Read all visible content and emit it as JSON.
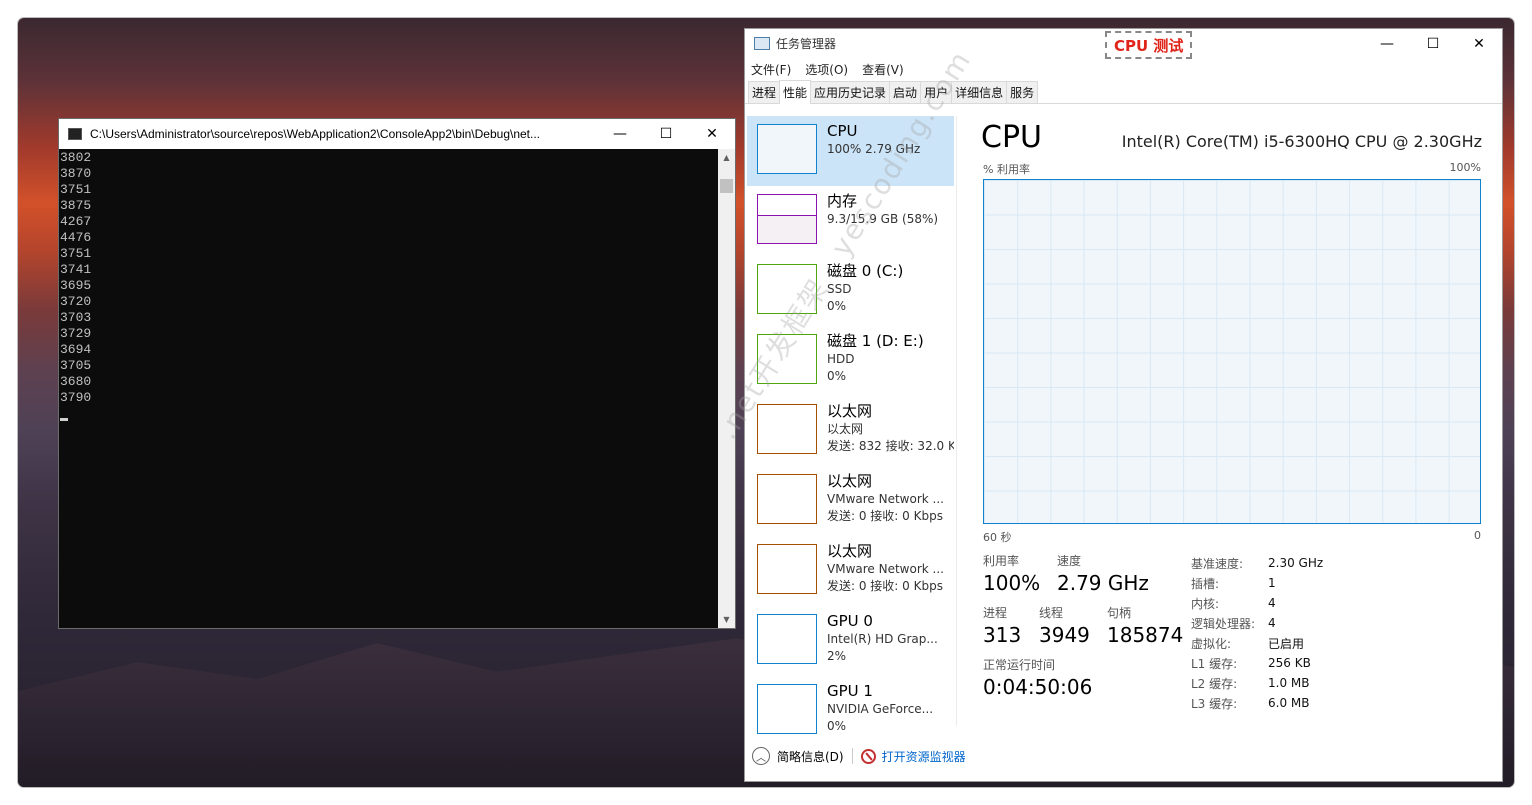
{
  "console": {
    "title": "C:\\Users\\Administrator\\source\\repos\\WebApplication2\\ConsoleApp2\\bin\\Debug\\net...",
    "minimize": "—",
    "maximize": "☐",
    "close": "✕",
    "lines": [
      "3802",
      "3870",
      "3751",
      "3875",
      "4267",
      "4476",
      "3751",
      "3741",
      "3695",
      "3720",
      "3703",
      "3729",
      "3694",
      "3705",
      "3680",
      "3790"
    ]
  },
  "annotation": {
    "label": "CPU 测试"
  },
  "taskmgr": {
    "title": "任务管理器",
    "minimize": "—",
    "maximize": "☐",
    "close": "✕",
    "menu": [
      "文件(F)",
      "选项(O)",
      "查看(V)"
    ],
    "tabs": [
      "进程",
      "性能",
      "应用历史记录",
      "启动",
      "用户",
      "详细信息",
      "服务"
    ],
    "active_tab": "性能",
    "items": [
      {
        "name": "CPU",
        "sub1": "100%  2.79 GHz",
        "sub2": "",
        "color": "#1183cc"
      },
      {
        "name": "内存",
        "sub1": "9.3/15.9 GB (58%)",
        "sub2": "",
        "color": "#8b12ae"
      },
      {
        "name": "磁盘 0 (C:)",
        "sub1": "SSD",
        "sub2": "0%",
        "color": "#4da60c"
      },
      {
        "name": "磁盘 1 (D: E:)",
        "sub1": "HDD",
        "sub2": "0%",
        "color": "#4da60c"
      },
      {
        "name": "以太网",
        "sub1": "以太网",
        "sub2": "发送: 832  接收: 32.0 K",
        "color": "#a74f01"
      },
      {
        "name": "以太网",
        "sub1": "VMware Network ...",
        "sub2": "发送: 0  接收: 0 Kbps",
        "color": "#a74f01"
      },
      {
        "name": "以太网",
        "sub1": "VMware Network ...",
        "sub2": "发送: 0  接收: 0 Kbps",
        "color": "#a74f01"
      },
      {
        "name": "GPU 0",
        "sub1": "Intel(R) HD Grap...",
        "sub2": "2%",
        "color": "#1183cc"
      },
      {
        "name": "GPU 1",
        "sub1": "NVIDIA GeForce...",
        "sub2": "0%",
        "color": "#1183cc"
      }
    ],
    "detail": {
      "title": "CPU",
      "model": "Intel(R) Core(TM) i5-6300HQ CPU @ 2.30GHz",
      "graph_label": "% 利用率",
      "graph_max": "100%",
      "axis_left": "60 秒",
      "axis_right": "0",
      "util_label": "利用率",
      "util_value": "100%",
      "speed_label": "速度",
      "speed_value": "2.79 GHz",
      "proc_label": "进程",
      "proc_value": "313",
      "thread_label": "线程",
      "thread_value": "3949",
      "handle_label": "句柄",
      "handle_value": "185874",
      "uptime_label": "正常运行时间",
      "uptime_value": "0:04:50:06",
      "specs": [
        {
          "k": "基准速度:",
          "v": "2.30 GHz"
        },
        {
          "k": "插槽:",
          "v": "1"
        },
        {
          "k": "内核:",
          "v": "4"
        },
        {
          "k": "逻辑处理器:",
          "v": "4"
        },
        {
          "k": "虚拟化:",
          "v": "已启用"
        },
        {
          "k": "L1 缓存:",
          "v": "256 KB"
        },
        {
          "k": "L2 缓存:",
          "v": "1.0 MB"
        },
        {
          "k": "L3 缓存:",
          "v": "6.0 MB"
        }
      ]
    },
    "footer": {
      "brief": "简略信息(D)",
      "open_monitor": "打开资源监视器"
    }
  },
  "watermark": ".net开发框架 · yescoding.com"
}
